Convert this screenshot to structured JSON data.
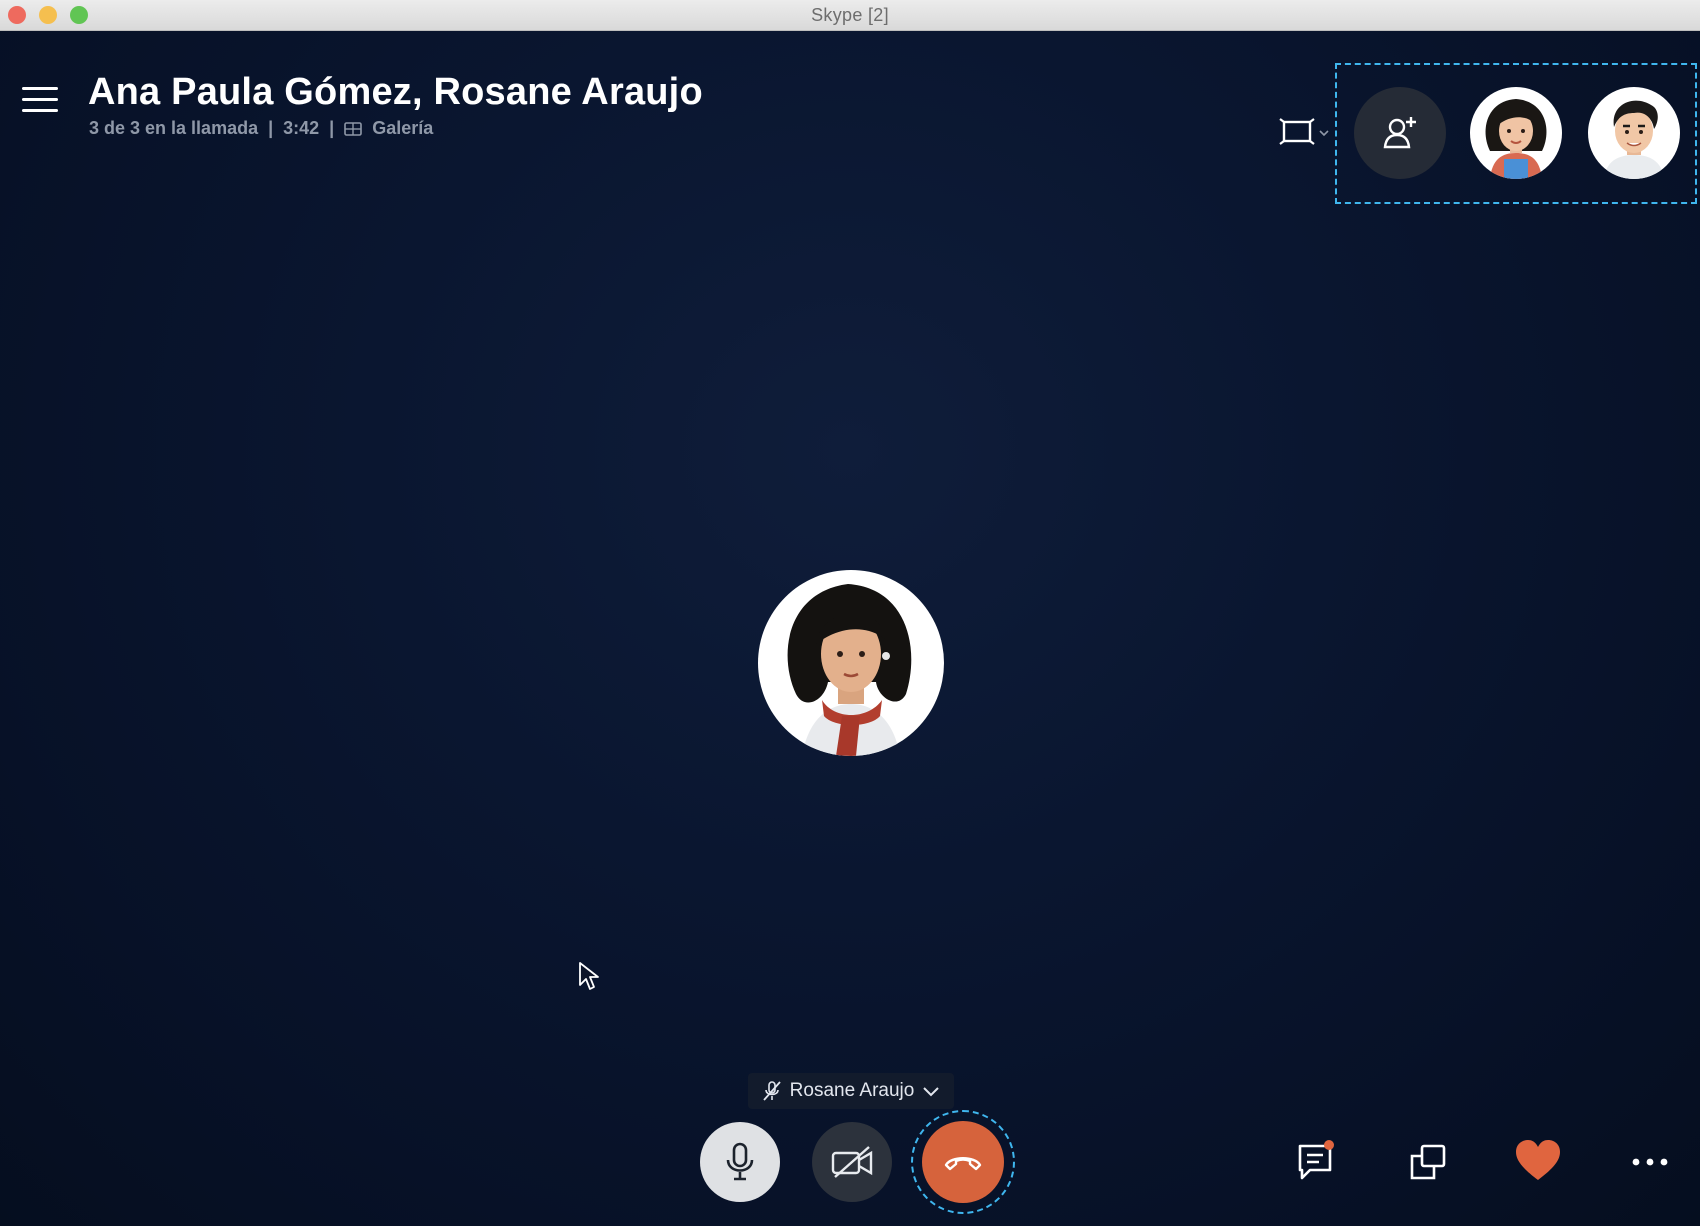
{
  "window": {
    "title": "Skype [2]"
  },
  "call": {
    "title": "Ana Paula Gómez, Rosane Araujo",
    "participants_count": "3 de 3 en la llamada",
    "separator": "|",
    "duration": "3:42",
    "view_mode": "Galería"
  },
  "speaker": {
    "name": "Rosane Araujo"
  },
  "participants": [
    {
      "avatar": "ana-paula-avatar"
    },
    {
      "avatar": "male-participant-avatar"
    }
  ],
  "main_avatar": "rosane-araujo-avatar",
  "controls": {
    "mic": "microphone-icon",
    "video": "video-off-icon",
    "hangup": "hang-up-icon",
    "chat": "chat-icon",
    "share": "share-screen-icon",
    "react": "heart-icon",
    "more": "more-icon"
  },
  "colors": {
    "hangup": "#d6633c",
    "focus_ring": "#3fb6ee",
    "notification_badge": "#e0653f"
  }
}
